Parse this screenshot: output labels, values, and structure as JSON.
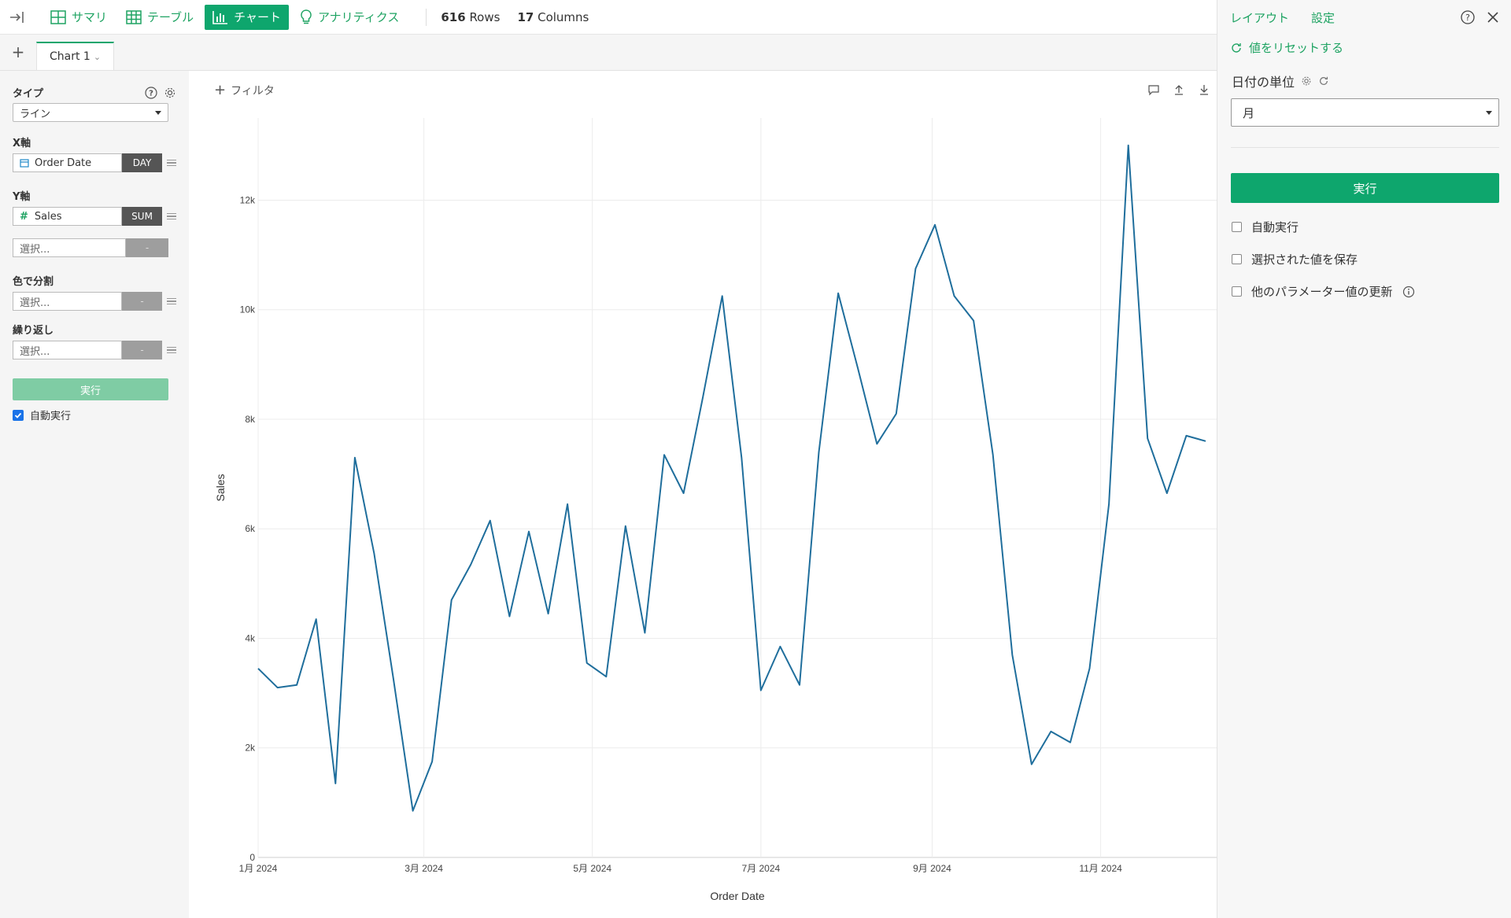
{
  "topbar": {
    "nav": [
      {
        "label": "サマリ",
        "icon": "grid-icon",
        "active": false
      },
      {
        "label": "テーブル",
        "icon": "table-icon",
        "active": false
      },
      {
        "label": "チャート",
        "icon": "bar-chart-icon",
        "active": true
      },
      {
        "label": "アナリティクス",
        "icon": "lightbulb-icon",
        "active": false
      }
    ],
    "rows_count": "616",
    "rows_label": "Rows",
    "cols_count": "17",
    "cols_label": "Columns"
  },
  "tabs": [
    {
      "label": "Chart 1"
    }
  ],
  "left": {
    "type_label": "タイプ",
    "type_value": "ライン",
    "x_label": "X軸",
    "x_field": "Order Date",
    "x_agg": "DAY",
    "y_label": "Y軸",
    "y_field": "Sales",
    "y_agg": "SUM",
    "y2_placeholder": "選択...",
    "y2_agg": "-",
    "color_label": "色で分割",
    "color_placeholder": "選択...",
    "color_agg": "-",
    "repeat_label": "繰り返し",
    "repeat_placeholder": "選択...",
    "repeat_agg": "-",
    "run_label": "実行",
    "auto_run_label": "自動実行",
    "auto_run_checked": true
  },
  "chart": {
    "filter_label": "フィルタ"
  },
  "chart_data": {
    "type": "line",
    "xlabel": "Order Date",
    "ylabel": "Sales",
    "ylim": [
      0,
      13500
    ],
    "yticks": [
      0,
      2000,
      4000,
      6000,
      8000,
      10000,
      12000
    ],
    "ytick_labels": [
      "0",
      "2k",
      "4k",
      "6k",
      "8k",
      "10k",
      "12k"
    ],
    "xlim": [
      "2024-01-01",
      "2024-12-13"
    ],
    "xticks": [
      "2024-01-01",
      "2024-03-01",
      "2024-05-01",
      "2024-07-01",
      "2024-09-01",
      "2024-11-01"
    ],
    "xtick_labels": [
      "1月 2024",
      "3月 2024",
      "5月 2024",
      "7月 2024",
      "9月 2024",
      "11月 2024"
    ],
    "grid": true,
    "color": "#1f6e9c",
    "series": [
      {
        "x": [
          "2024-01-01",
          "2024-01-08",
          "2024-01-15",
          "2024-01-22",
          "2024-01-29",
          "2024-02-05",
          "2024-02-12",
          "2024-02-19",
          "2024-02-26",
          "2024-03-04",
          "2024-03-11",
          "2024-03-18",
          "2024-03-25",
          "2024-04-01",
          "2024-04-08",
          "2024-04-15",
          "2024-04-22",
          "2024-04-29",
          "2024-05-06",
          "2024-05-13",
          "2024-05-20",
          "2024-05-27",
          "2024-06-03",
          "2024-06-10",
          "2024-06-17",
          "2024-06-24",
          "2024-07-01",
          "2024-07-08",
          "2024-07-15",
          "2024-07-22",
          "2024-07-29",
          "2024-08-05",
          "2024-08-12",
          "2024-08-19",
          "2024-08-26",
          "2024-09-02",
          "2024-09-09",
          "2024-09-16",
          "2024-09-23",
          "2024-09-30",
          "2024-10-07",
          "2024-10-14",
          "2024-10-21",
          "2024-10-28",
          "2024-11-04",
          "2024-11-11",
          "2024-11-18",
          "2024-11-25",
          "2024-12-02",
          "2024-12-09"
        ],
        "values": [
          3450,
          3100,
          3150,
          4350,
          1350,
          7300,
          5550,
          3250,
          850,
          1750,
          4700,
          5350,
          6150,
          4400,
          5950,
          4450,
          6450,
          3550,
          3300,
          6050,
          4100,
          7350,
          6650,
          8400,
          10250,
          7300,
          3050,
          3850,
          3150,
          7400,
          10300,
          8950,
          7550,
          8100,
          10750,
          11550,
          10250,
          9800,
          7350,
          3700,
          1700,
          2300,
          2100,
          3450,
          6450,
          13000,
          7650,
          6650,
          7700,
          7600
        ]
      }
    ]
  },
  "right": {
    "tab_layout": "レイアウト",
    "tab_settings": "設定",
    "reset_label": "値をリセットする",
    "unit_label": "日付の単位",
    "unit_value": "月",
    "run_label": "実行",
    "options": [
      {
        "label": "自動実行",
        "checked": false
      },
      {
        "label": "選択された値を保存",
        "checked": false
      },
      {
        "label": "他のパラメーター値の更新",
        "checked": false
      }
    ]
  }
}
